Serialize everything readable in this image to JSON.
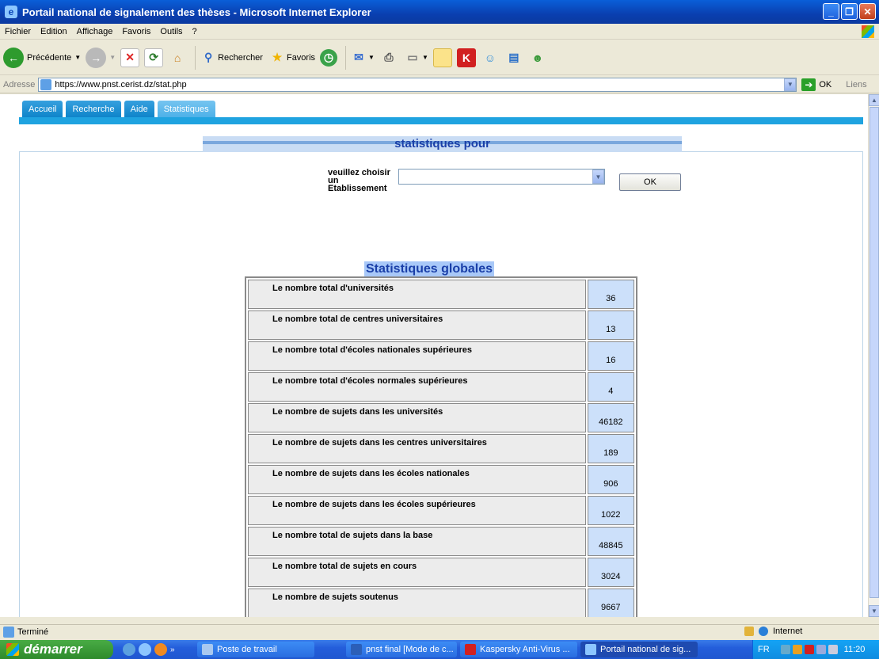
{
  "window": {
    "title": "Portail national de signalement des thèses - Microsoft Internet Explorer"
  },
  "menu": [
    "Fichier",
    "Edition",
    "Affichage",
    "Favoris",
    "Outils",
    "?"
  ],
  "toolbar": {
    "back_label": "Précédente",
    "search_label": "Rechercher",
    "favorites_label": "Favoris"
  },
  "address": {
    "label": "Adresse",
    "url": "https://www.pnst.cerist.dz/stat.php",
    "go_label": "OK",
    "links_label": "Liens"
  },
  "tabs": [
    {
      "label": "Accueil",
      "active": false
    },
    {
      "label": "Recherche",
      "active": false
    },
    {
      "label": "Aide",
      "active": false
    },
    {
      "label": "Statistiques",
      "active": true
    }
  ],
  "page": {
    "stat_title": "statistiques pour",
    "choose_label_1": "veuillez choisir",
    "choose_label_2": "un",
    "choose_label_3": "Etablissement",
    "select_value": "",
    "ok_label": "OK",
    "globals_title": "Statistiques globales"
  },
  "stats": [
    {
      "label": "Le nombre total d'universités",
      "value": "36"
    },
    {
      "label": "Le nombre total de centres universitaires",
      "value": "13"
    },
    {
      "label": "Le nombre total d'écoles nationales supérieures",
      "value": "16"
    },
    {
      "label": "Le nombre total d'écoles normales supérieures",
      "value": "4"
    },
    {
      "label": "Le nombre de sujets dans les universités",
      "value": "46182"
    },
    {
      "label": "Le nombre de sujets dans les centres universitaires",
      "value": "189"
    },
    {
      "label": "Le nombre de sujets dans les écoles nationales",
      "value": "906"
    },
    {
      "label": "Le nombre de sujets dans les écoles supérieures",
      "value": "1022"
    },
    {
      "label": "Le nombre total de sujets dans la base",
      "value": "48845"
    },
    {
      "label": "Le nombre total de sujets en cours",
      "value": "3024"
    },
    {
      "label": "Le nombre de sujets soutenus",
      "value": "9667"
    }
  ],
  "status": {
    "text": "Terminé",
    "zone": "Internet"
  },
  "taskbar": {
    "start_label": "démarrer",
    "tasks": [
      {
        "label": "Poste de travail",
        "active": false
      },
      {
        "label": "pnst final [Mode de c...",
        "active": false
      },
      {
        "label": "Kaspersky Anti-Virus ...",
        "active": false
      },
      {
        "label": "Portail national de sig...",
        "active": true
      }
    ],
    "lang": "FR",
    "clock": "11:20"
  }
}
